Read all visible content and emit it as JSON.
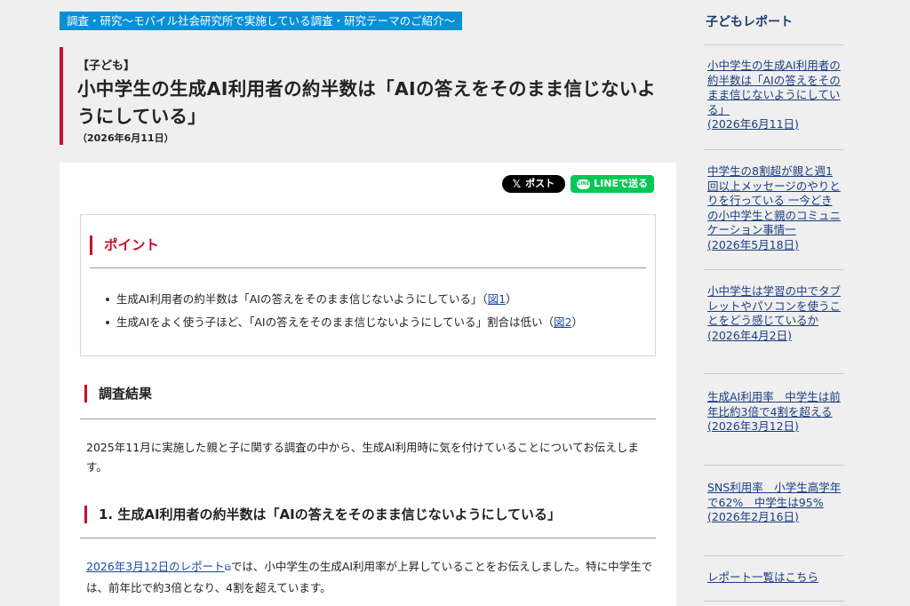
{
  "banner": "調査・研究～モバイル社会研究所で実施している調査・研究テーマのご紹介～",
  "article": {
    "category": "【子ども】",
    "title": "小中学生の生成AI利用者の約半数は「AIの答えをそのまま信じないようにしている」",
    "date": "（2026年6月11日）"
  },
  "share": {
    "x_label": "ポスト",
    "line_label": "LINEで送る",
    "line_icon_text": "LINE"
  },
  "points": {
    "heading": "ポイント",
    "items": [
      {
        "text": "生成AI利用者の約半数は「AIの答えをそのまま信じないようにしている」（",
        "link": "図1",
        "after": "）"
      },
      {
        "text": "生成AIをよく使う子ほど、「AIの答えをそのまま信じないようにしている」割合は低い（",
        "link": "図2",
        "after": "）"
      }
    ]
  },
  "results": {
    "heading": "調査結果",
    "intro": "2025年11月に実施した親と子に関する調査の中から、生成AI利用時に気を付けていることについてお伝えします。"
  },
  "section1": {
    "heading": "1. 生成AI利用者の約半数は「AIの答えをそのまま信じないようにしている」",
    "link_text": "2026年3月12日のレポート",
    "text_after_link": "では、小中学生の生成AI利用率が上昇していることをお伝えしました。特に中学生では、前年比で約3倍となり、4割を超えています。"
  },
  "sidebar": {
    "title": "子どもレポート",
    "items": [
      "小中学生の生成AI利用者の約半数は「AIの答えをそのまま信じないようにしている」\n(2026年6月11日)",
      "中学生の8割超が親と週1回以上メッセージのやりとりを行っている 一今どきの小中学生と親のコミュニケーション事情一\n(2026年5月18日)",
      "小中学生は学習の中でタブレットやパソコンを使うことをどう感じているか\n(2026年4月2日)",
      "生成AI利用率　中学生は前年比約3倍で4割を超える\n(2026年3月12日)",
      "SNS利用率　小学生高学年で62%　中学生は95%\n(2026年2月16日)"
    ],
    "all_link": "レポート一覧はこちら"
  }
}
